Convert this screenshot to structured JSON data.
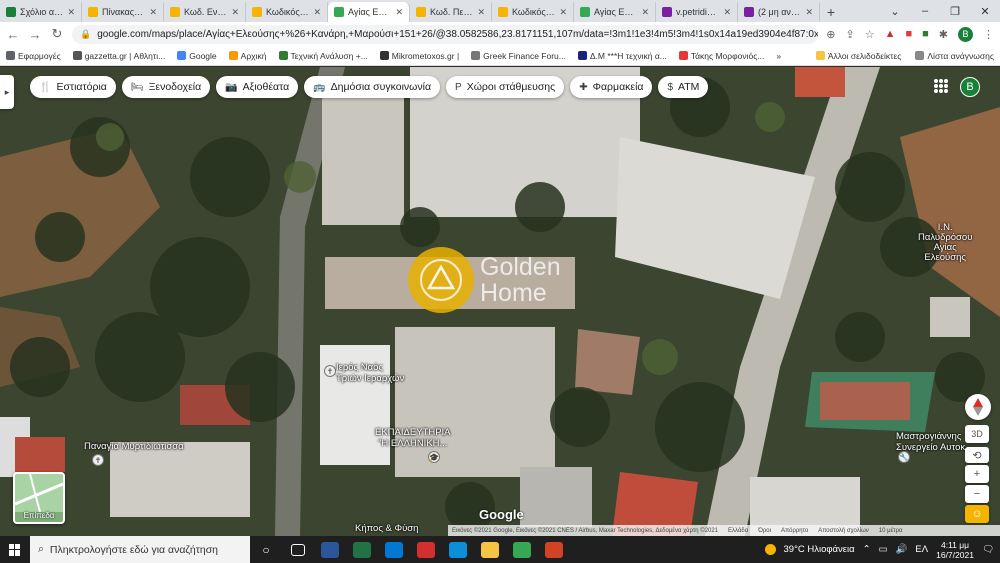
{
  "browser": {
    "tabs": [
      {
        "title": "Σχόλιο αγο...",
        "color": "#188038"
      },
      {
        "title": "Πίνακας ελ...",
        "color": "#f4b400"
      },
      {
        "title": "Κωδ. Εντολ...",
        "color": "#f4b400"
      },
      {
        "title": "Κωδικός Αν...",
        "color": "#f4b400"
      },
      {
        "title": "Αγίας Ελεο...",
        "color": "#34a853",
        "active": true
      },
      {
        "title": "Κωδ. Πελάτ...",
        "color": "#f4b400"
      },
      {
        "title": "Κωδικός Αν...",
        "color": "#f4b400"
      },
      {
        "title": "Αγίας Ελεο...",
        "color": "#34a853"
      },
      {
        "title": "v.petridis@...",
        "color": "#7b1fa2"
      },
      {
        "title": "(2 μη αναγ...",
        "color": "#7b1fa2"
      }
    ],
    "url": "google.com/maps/place/Αγίας+Ελεούσης+%26+Κανάρη,+Μαρούσι+151+26/@38.0582586,23.8171151,107m/data=!3m1!1e3!4m5!3m4!1s0x14a19ed3904e4f87:0x3010fd1cf88040ef8..."
  },
  "bookmarks": {
    "items": [
      {
        "label": "Εφαρμογές",
        "color": "#5f6368"
      },
      {
        "label": "gazzetta.gr | Αθλητι...",
        "color": "#555"
      },
      {
        "label": "Google",
        "color": "#4285f4"
      },
      {
        "label": "Αρχική",
        "color": "#ff9800"
      },
      {
        "label": "Τεχνική Ανάλυση +...",
        "color": "#2e7d32"
      },
      {
        "label": "Mikrometoxos.gr |",
        "color": "#333"
      },
      {
        "label": "Greek Finance Foru...",
        "color": "#777"
      },
      {
        "label": "Δ.Μ ***Η τεχνική α...",
        "color": "#1a237e"
      },
      {
        "label": "Τάκης Μορφονιός...",
        "color": "#e53935"
      }
    ],
    "more": "»",
    "other": "Άλλοι σελιδοδείκτες",
    "reading": "Λίστα ανάγνωσης"
  },
  "map": {
    "chips": [
      {
        "icon": "restaurant-icon",
        "glyph": "🍴",
        "label": "Εστιατόρια"
      },
      {
        "icon": "hotel-icon",
        "glyph": "🛏",
        "label": "Ξενοδοχεία"
      },
      {
        "icon": "camera-icon",
        "glyph": "📷",
        "label": "Αξιοθέατα"
      },
      {
        "icon": "transit-icon",
        "glyph": "🚌",
        "label": "Δημόσια συγκοινωνία"
      },
      {
        "icon": "parking-icon",
        "glyph": "P",
        "label": "Χώροι στάθμευσης"
      },
      {
        "icon": "pharmacy-icon",
        "glyph": "✚",
        "label": "Φαρμακεία"
      },
      {
        "icon": "atm-icon",
        "glyph": "$",
        "label": "ATM"
      }
    ],
    "account_initial": "B",
    "labels": {
      "church1_line1": "Ιερός Ναός",
      "church1_line2": "Τριών Ιεραρχών",
      "school_line1": "ΕΚΠΑΙΔΕΥΤΗΡΙΑ",
      "school_line2": "\"Η ΕΛΛΗΝΙΚΗ...",
      "church2": "Παναγία Μυρτιδιώτισσα",
      "church3_line1": "Ι.Ν.",
      "church3_line2": "Παλυδρόσου",
      "church3_line3": "Αγίας",
      "church3_line4": "Ελεούσης",
      "workshop_line1": "Μαστρογιάννης",
      "workshop_line2": "Συνεργείο Αυτοκ...",
      "cafe": "Κήπος & Φύση"
    },
    "watermark": {
      "line1": "Golden",
      "line2": "Home"
    },
    "layer_label": "Επίπεδα",
    "google_logo": "Google",
    "controls": {
      "tilt": "3D",
      "zoom_in": "+",
      "zoom_out": "−"
    },
    "attribution": [
      "Εικόνες ©2021 Google, Εικόνες ©2021 CNES / Airbus, Maxar Technologies, Δεδομένα χάρτη ©2021",
      "Ελλάδα",
      "Όροι",
      "Απόρρητο",
      "Αποστολή σχολίων",
      "10 μέτρα"
    ]
  },
  "taskbar": {
    "search_placeholder": "Πληκτρολογήστε εδώ για αναζήτηση",
    "apps": [
      {
        "name": "taskview-icon",
        "color": "#1f1f1f"
      },
      {
        "name": "word-icon",
        "color": "#2b579a"
      },
      {
        "name": "excel-icon",
        "color": "#217346"
      },
      {
        "name": "photos-icon",
        "color": "#0078d4"
      },
      {
        "name": "anydesk-icon",
        "color": "#d32f2f"
      },
      {
        "name": "edge-icon",
        "color": "#0c8ed9"
      },
      {
        "name": "explorer-icon",
        "color": "#f4c542"
      },
      {
        "name": "chrome-icon",
        "color": "#34a853"
      },
      {
        "name": "powerpoint-icon",
        "color": "#d04423"
      }
    ],
    "weather": "39°C Ηλιοφάνεια",
    "lang": "ΕΛ",
    "time": "4:11 μμ",
    "date": "16/7/2021"
  }
}
